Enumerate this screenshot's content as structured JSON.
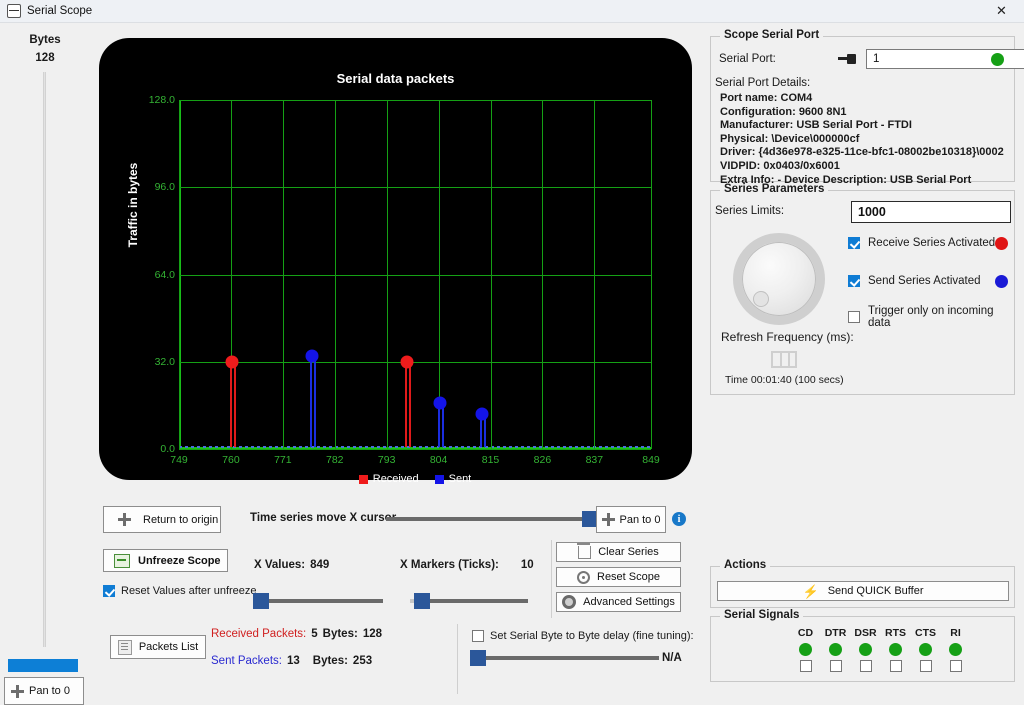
{
  "window": {
    "title": "Serial Scope",
    "close_label": "✕",
    "icon": "scope-icon"
  },
  "left_panel": {
    "caption": "Bytes",
    "value": "128",
    "pan_button": "Pan to 0"
  },
  "chart_data": {
    "type": "scatter",
    "title": "Serial data packets",
    "xlabel": "",
    "ylabel": "Traffic in bytes",
    "ylim": [
      0,
      128
    ],
    "yticks": [
      "0.0",
      "32.0",
      "64.0",
      "96.0",
      "128.0"
    ],
    "ytick_values": [
      0,
      32,
      64,
      96,
      128
    ],
    "xlim": [
      749,
      849
    ],
    "xticks": [
      "749",
      "760",
      "771",
      "782",
      "793",
      "804",
      "815",
      "826",
      "837",
      "849"
    ],
    "xtick_values": [
      749,
      760,
      771,
      782,
      793,
      804,
      815,
      826,
      837,
      849
    ],
    "grid": true,
    "legend_position": "bottom",
    "background": "#000000",
    "grid_color": "#15a015",
    "baseline_color": "#4a6fe0",
    "series": [
      {
        "name": "Received",
        "color": "#ef1c1c",
        "points": [
          {
            "x": 760,
            "y": 32
          },
          {
            "x": 797,
            "y": 32
          }
        ]
      },
      {
        "name": "Sent",
        "color": "#1414e8",
        "points": [
          {
            "x": 777,
            "y": 34
          },
          {
            "x": 804,
            "y": 17
          },
          {
            "x": 813,
            "y": 13
          }
        ]
      }
    ]
  },
  "scope_controls": {
    "return_to_origin": "Return to origin",
    "time_series_label": "Time series move X cursor",
    "x_cursor_value": 100,
    "pan_to_0": "Pan to 0",
    "info_icon": "i",
    "unfreeze_scope": "Unfreeze Scope",
    "reset_values_label": "Reset Values after unfreeze",
    "reset_values_checked": true,
    "x_values_label": "X Values:",
    "x_values": "849",
    "x_markers_label": "X Markers (Ticks):",
    "x_markers": "10",
    "slider_a_value": 5,
    "slider_b_value": 10,
    "clear_series": "Clear Series",
    "reset_scope": "Reset Scope",
    "advanced_settings": "Advanced Settings",
    "packets_list": "Packets List",
    "received_packets_label": "Received Packets:",
    "received_packets": "5",
    "received_bytes_label": "Bytes:",
    "received_bytes": "128",
    "sent_packets_label": "Sent Packets:",
    "sent_packets": "13",
    "sent_bytes_label": "Bytes:",
    "sent_bytes": "253",
    "byte_delay_label": "Set Serial Byte to Byte delay (fine tuning):",
    "byte_delay_checked": false,
    "byte_delay_value": "N/A",
    "byte_delay_slider": 2
  },
  "scope_serial_port": {
    "group_title": "Scope Serial Port",
    "port_label": "Serial Port:",
    "port_value": "1",
    "port_placeholder": "",
    "status_color": "#16a016",
    "details_label": "Serial Port Details:",
    "details": [
      "Port name: COM4",
      "Configuration: 9600 8N1",
      "Manufacturer: USB Serial Port - FTDI",
      "Physical: \\Device\\000000cf",
      "Driver: {4d36e978-e325-11ce-bfc1-08002be10318}\\0002",
      "VIDPID: 0x0403/0x6001",
      "Extra Info:  - Device Description: USB Serial Port"
    ]
  },
  "series_parameters": {
    "group_title": "Series Parameters",
    "limits_label": "Series Limits:",
    "limits_value": "1000",
    "receive_label": "Receive Series Activated",
    "receive_checked": true,
    "receive_color": "#e01414",
    "send_label": "Send Series Activated",
    "send_checked": true,
    "send_color": "#1a1ad6",
    "trigger_label": "Trigger only on incoming data",
    "trigger_checked": false,
    "refresh_label": "Refresh Frequency (ms):",
    "time_label": "Time 00:01:40 (100 secs)"
  },
  "actions": {
    "group_title": "Actions",
    "send_quick_buffer": "Send QUICK Buffer"
  },
  "serial_signals": {
    "group_title": "Serial Signals",
    "signals": [
      "CD",
      "DTR",
      "DSR",
      "RTS",
      "CTS",
      "RI"
    ],
    "led_color": "#16a016",
    "checked": [
      false,
      false,
      false,
      false,
      false,
      false
    ]
  }
}
